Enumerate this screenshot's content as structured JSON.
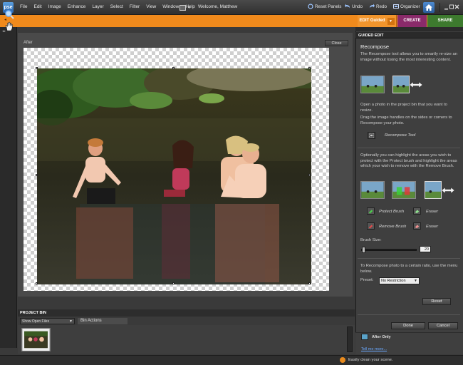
{
  "app": {
    "logo": "pse",
    "menu": [
      "File",
      "Edit",
      "Image",
      "Enhance",
      "Layer",
      "Select",
      "Filter",
      "View",
      "Window",
      "Help"
    ],
    "welcome": "Welcome, Matthew"
  },
  "toolbar": {
    "reset_panels": "Reset Panels",
    "undo": "Undo",
    "redo": "Redo",
    "organizer": "Organizer"
  },
  "modes": {
    "edit_guided": "EDIT Guided",
    "create": "CREATE",
    "share": "SHARE"
  },
  "document": {
    "view_label": "After",
    "close_label": "Close"
  },
  "project_bin": {
    "title": "PROJECT BIN",
    "show_option": "Show Open Files",
    "bin_actions": "Bin Actions"
  },
  "panel": {
    "header": "GUIDED EDIT",
    "title": "Recompose",
    "intro": "The Recompose tool allows you to smartly re-size an image without losing the most interesting content.",
    "step1": "Open a photo in the project bin that you want to resize.",
    "step2": "Drag the image handles on the sides or corners to Recompose your photo.",
    "recompose_tool": "Recompose Tool",
    "highlight_text": "Optionally you can highlight the areas you wish to protect with the Protect brush and highlight the areas which your wish to remove with the Remove Brush.",
    "protect_brush": "Protect Brush",
    "eraser_1": "Eraser",
    "remove_brush": "Remove Brush",
    "eraser_2": "Eraser",
    "brush_size_label": "Brush Size:",
    "brush_size_value": "20",
    "brush_size_fraction": 0.02,
    "ratio_text": "To Recompose photo to a certain ratio, use the menu below.",
    "preset_label": "Preset:",
    "preset_value": "No Restriction",
    "reset": "Reset",
    "done": "Done",
    "cancel": "Cancel",
    "after_only": "After Only",
    "tell_more": "Tell me more..."
  },
  "status": {
    "text": "Easily clean your scene."
  },
  "colors": {
    "accent_orange": "#f08a1c",
    "create_purple": "#8a2a6a",
    "share_green": "#3d7a2e",
    "link_blue": "#6aa9ff"
  }
}
